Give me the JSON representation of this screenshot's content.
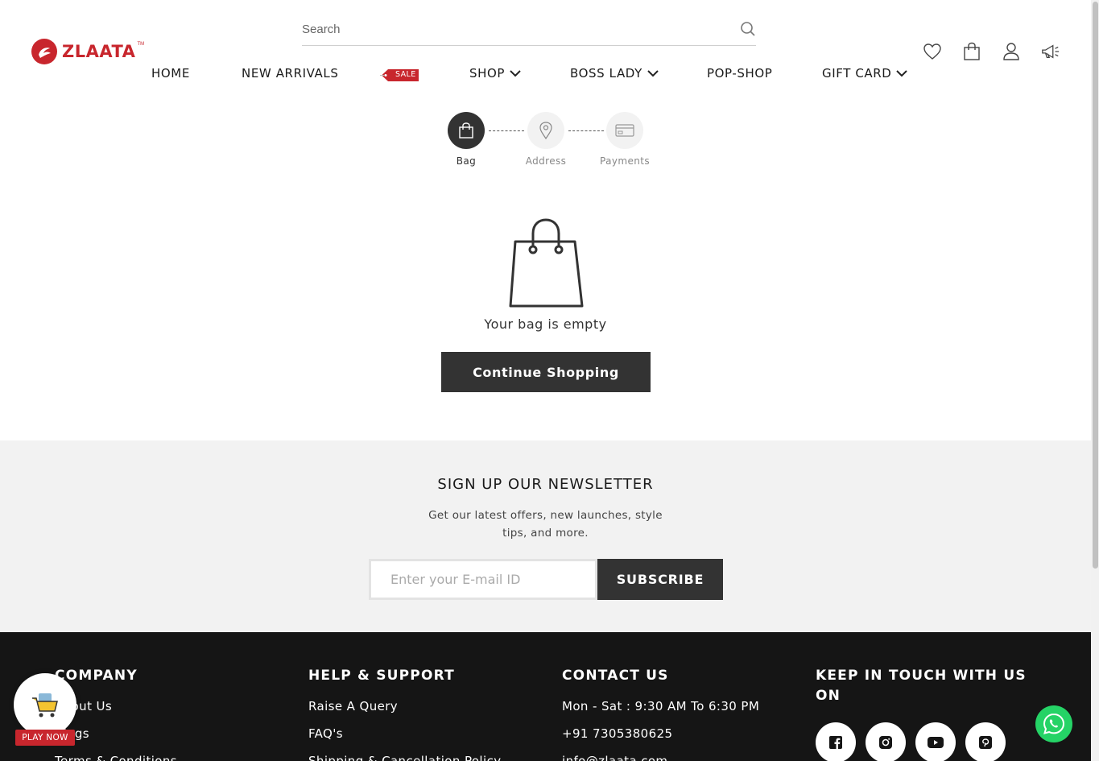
{
  "brand": {
    "name": "ZLAATA",
    "trademark": "TM",
    "color": "#c8262d"
  },
  "search": {
    "placeholder": "Search"
  },
  "nav": {
    "home": "HOME",
    "new_arrivals": "NEW ARRIVALS",
    "sale_badge": "SALE",
    "shop": "SHOP",
    "boss_lady": "BOSS LADY",
    "pop_shop": "POP-SHOP",
    "gift_card": "GIFT CARD"
  },
  "header_icons": [
    "heart-icon",
    "bag-icon",
    "user-icon",
    "megaphone-icon"
  ],
  "checkout_steps": [
    {
      "label": "Bag",
      "state": "active",
      "icon": "bag-icon"
    },
    {
      "label": "Address",
      "state": "inactive",
      "icon": "location-pin-icon"
    },
    {
      "label": "Payments",
      "state": "inactive",
      "icon": "card-icon"
    }
  ],
  "empty_bag": {
    "message": "Your bag is empty",
    "button": "Continue Shopping"
  },
  "newsletter": {
    "title": "SIGN UP OUR NEWSLETTER",
    "description": "Get our latest offers, new launches, style tips, and more.",
    "placeholder": "Enter your E-mail ID",
    "button": "SUBSCRIBE"
  },
  "footer": {
    "company": {
      "title": "COMPANY",
      "items": [
        "About Us",
        "Blogs",
        "Terms & Conditions"
      ]
    },
    "help": {
      "title": "HELP & SUPPORT",
      "items": [
        "Raise A Query",
        "FAQ's",
        "Shipping & Cancellation Policy"
      ]
    },
    "contact": {
      "title": "CONTACT US",
      "items": [
        "Mon - Sat : 9:30 AM To 6:30 PM",
        "+91 7305380625",
        "info@zlaata.com"
      ]
    },
    "social": {
      "title": "KEEP IN TOUCH WITH US ON",
      "icons": [
        "facebook-icon",
        "instagram-icon",
        "youtube-icon",
        "pinterest-icon"
      ]
    }
  },
  "floating": {
    "play_now": "PLAY NOW",
    "whatsapp_icon": "whatsapp-icon"
  },
  "colors": {
    "dark": "#333333",
    "footer_bg": "#151515",
    "newsletter_bg": "#f2f2f2",
    "whatsapp": "#25d366"
  }
}
